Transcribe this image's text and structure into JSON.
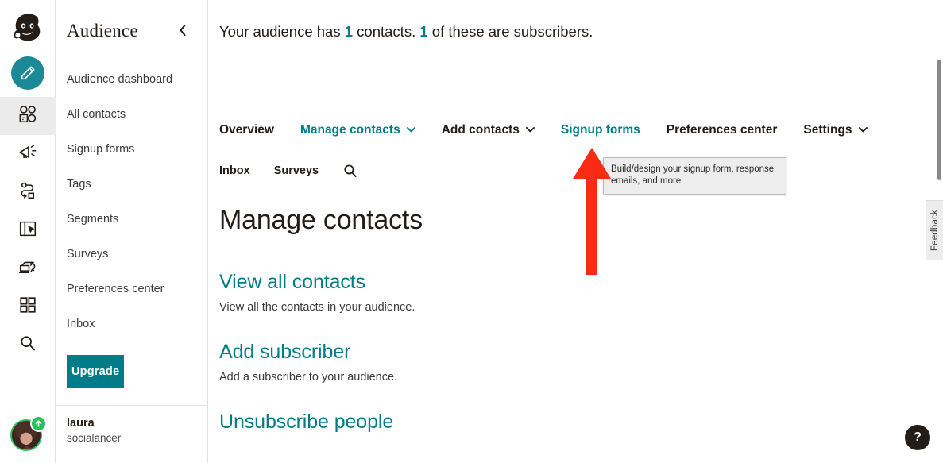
{
  "colors": {
    "teal": "#007c89",
    "teal_pencil": "#1b8a96",
    "dark": "#241c15",
    "green_badge": "#27c05f",
    "arrow_red": "#fa2b14",
    "rail_active_bg": "#ebebeb"
  },
  "rail": {
    "logo_label": "mailchimp-freddie-logo",
    "items": [
      {
        "name": "create-campaign",
        "icon": "pencil-icon"
      },
      {
        "name": "audience",
        "icon": "audience-faces-icon",
        "active": true
      },
      {
        "name": "campaigns",
        "icon": "megaphone-icon"
      },
      {
        "name": "automations",
        "icon": "journey-path-icon"
      },
      {
        "name": "landing-pages",
        "icon": "landing-page-icon"
      },
      {
        "name": "content-studio",
        "icon": "postcard-icon"
      },
      {
        "name": "integrations",
        "icon": "grid-apps-icon"
      },
      {
        "name": "search",
        "icon": "search-icon"
      }
    ]
  },
  "sidebar": {
    "title": "Audience",
    "collapse_icon": "chevron-left-icon",
    "items": [
      {
        "label": "Audience dashboard"
      },
      {
        "label": "All contacts"
      },
      {
        "label": "Signup forms"
      },
      {
        "label": "Tags"
      },
      {
        "label": "Segments"
      },
      {
        "label": "Surveys"
      },
      {
        "label": "Preferences center"
      },
      {
        "label": "Inbox"
      }
    ],
    "upgrade_label": "Upgrade",
    "account": {
      "name": "laura",
      "org": "socialancer",
      "badge_icon": "arrow-up-badge-icon"
    }
  },
  "main": {
    "summary": {
      "prefix": "Your audience has ",
      "contacts_count": "1",
      "middle": " contacts. ",
      "subscribers_count": "1",
      "suffix": " of these are subscribers."
    },
    "primary_nav": [
      {
        "label": "Overview",
        "teal": false,
        "caret": false
      },
      {
        "label": "Manage contacts",
        "teal": true,
        "caret": true
      },
      {
        "label": "Add contacts",
        "teal": false,
        "caret": true
      },
      {
        "label": "Signup forms",
        "teal": true,
        "caret": false
      },
      {
        "label": "Preferences center",
        "teal": false,
        "caret": false
      },
      {
        "label": "Settings",
        "teal": false,
        "caret": true
      }
    ],
    "secondary_nav": [
      {
        "label": "Inbox"
      },
      {
        "label": "Surveys"
      }
    ],
    "secondary_search_icon": "search-icon",
    "page_title": "Manage contacts",
    "sections": [
      {
        "link": "View all contacts",
        "desc": "View all the contacts in your audience."
      },
      {
        "link": "Add subscriber",
        "desc": "Add a subscriber to your audience."
      },
      {
        "link": "Unsubscribe people",
        "desc": ""
      }
    ]
  },
  "tooltip": {
    "text": "Build/design your signup form, response emails, and more"
  },
  "annotation": {
    "arrow": "red-up-arrow",
    "points_to": "Signup forms"
  },
  "feedback_tab": {
    "label": "Feedback"
  },
  "help_button": {
    "label": "?"
  },
  "caret_glyph": "⌄",
  "chevron_left_glyph": "‹"
}
